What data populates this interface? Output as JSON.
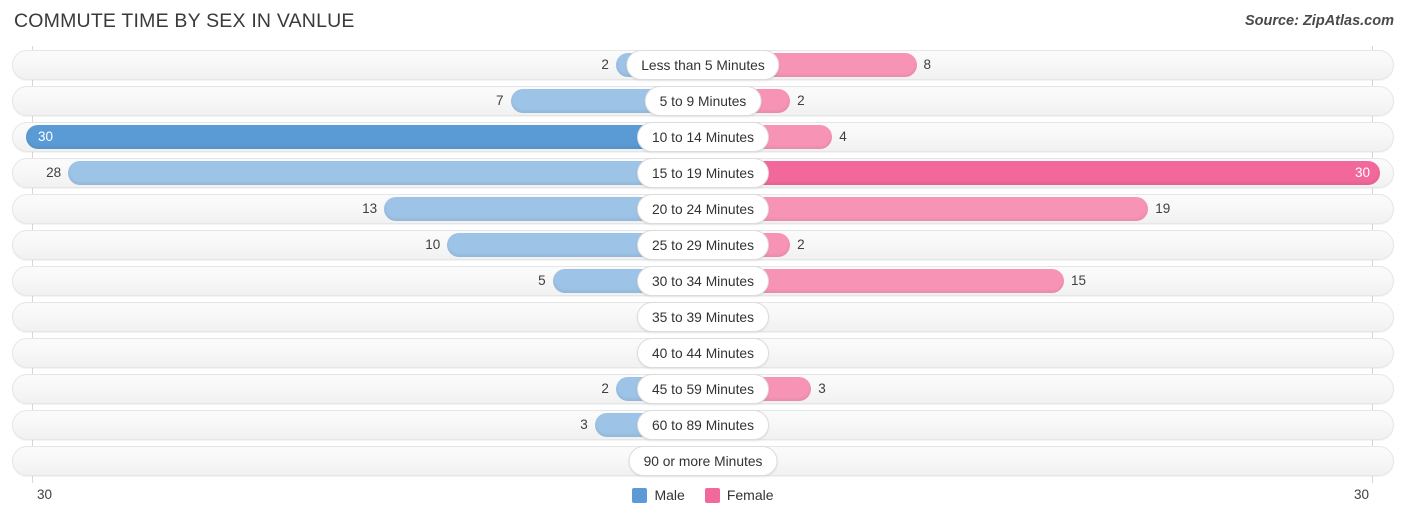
{
  "header": {
    "title": "COMMUTE TIME BY SEX IN VANLUE",
    "source": "Source: ZipAtlas.com"
  },
  "legend": {
    "items": [
      {
        "label": "Male",
        "color": "#5b9bd5"
      },
      {
        "label": "Female",
        "color": "#f2689b"
      }
    ]
  },
  "axis": {
    "left_label": "30",
    "right_label": "30",
    "max": 30
  },
  "chart_data": {
    "type": "bar",
    "title": "COMMUTE TIME BY SEX IN VANLUE",
    "subtitle": "Source: ZipAtlas.com",
    "orientation": "horizontal-diverging",
    "xlabel": "",
    "ylabel": "",
    "xlim": [
      30,
      30
    ],
    "grid": false,
    "legend_position": "bottom-center",
    "categories": [
      "Less than 5 Minutes",
      "5 to 9 Minutes",
      "10 to 14 Minutes",
      "15 to 19 Minutes",
      "20 to 24 Minutes",
      "25 to 29 Minutes",
      "30 to 34 Minutes",
      "35 to 39 Minutes",
      "40 to 44 Minutes",
      "45 to 59 Minutes",
      "60 to 89 Minutes",
      "90 or more Minutes"
    ],
    "series": [
      {
        "name": "Male",
        "color": "#9dc3e6",
        "highlight_color": "#5b9bd5",
        "side": "left",
        "values": [
          2,
          7,
          30,
          28,
          13,
          10,
          5,
          0,
          0,
          2,
          3,
          0
        ]
      },
      {
        "name": "Female",
        "color": "#f794b6",
        "highlight_color": "#f2689b",
        "side": "right",
        "values": [
          8,
          2,
          4,
          30,
          19,
          2,
          15,
          0,
          0,
          3,
          0,
          0
        ]
      }
    ]
  }
}
